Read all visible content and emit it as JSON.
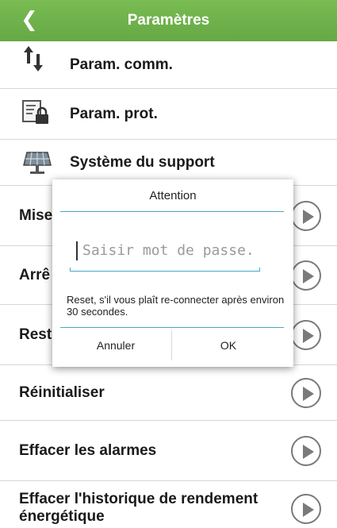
{
  "header": {
    "title": "Paramètres",
    "back_icon": "chevron-left-icon"
  },
  "items": [
    {
      "label": "Param. comm.",
      "icon": "transfer-arrows-icon"
    },
    {
      "label": "Param. prot.",
      "icon": "lock-document-icon"
    },
    {
      "label": "Système du support",
      "icon": "solar-panel-icon"
    },
    {
      "label": "Mise"
    },
    {
      "label": "Arrê"
    },
    {
      "label": "Rest"
    },
    {
      "label": "Réinitialiser"
    },
    {
      "label": "Effacer les alarmes"
    },
    {
      "label": "Effacer l'historique de rendement énergétique"
    }
  ],
  "dialog": {
    "title": "Attention",
    "password_placeholder": "Saisir mot de passe.",
    "message": "Reset, s'il vous plaît re-connecter après environ 30 secondes.",
    "cancel_label": "Annuler",
    "ok_label": "OK"
  },
  "colors": {
    "header_green": "#6fb24c",
    "accent_blue": "#47a7c3"
  }
}
